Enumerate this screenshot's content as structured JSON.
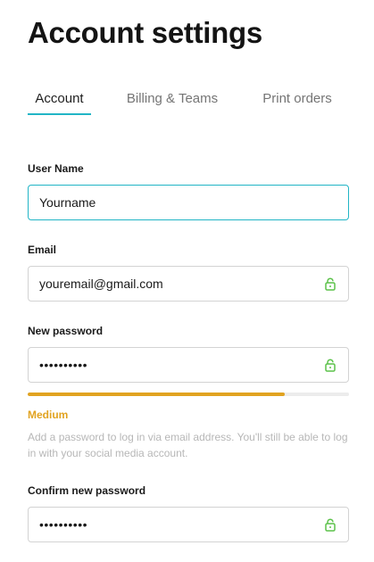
{
  "page": {
    "title": "Account settings"
  },
  "tabs": [
    {
      "label": "Account",
      "active": true
    },
    {
      "label": "Billing & Teams",
      "active": false
    },
    {
      "label": "Print orders",
      "active": false
    }
  ],
  "form": {
    "username": {
      "label": "User Name",
      "value": "Yourname"
    },
    "email": {
      "label": "Email",
      "value": "youremail@gmail.com",
      "icon": "lock-icon"
    },
    "new_password": {
      "label": "New password",
      "value": "••••••••••",
      "icon": "lock-icon"
    },
    "strength": {
      "label": "Medium",
      "level_percent": 80
    },
    "helper_text": "Add a password to log in via email address. You'll still be able to log in with your social media account.",
    "confirm_password": {
      "label": "Confirm new password",
      "value": "••••••••••",
      "icon": "lock-icon"
    }
  },
  "colors": {
    "accent": "#21b5c6",
    "lock": "#5cc24a",
    "strength_medium": "#e1a321",
    "helper": "#b7b7b7"
  }
}
